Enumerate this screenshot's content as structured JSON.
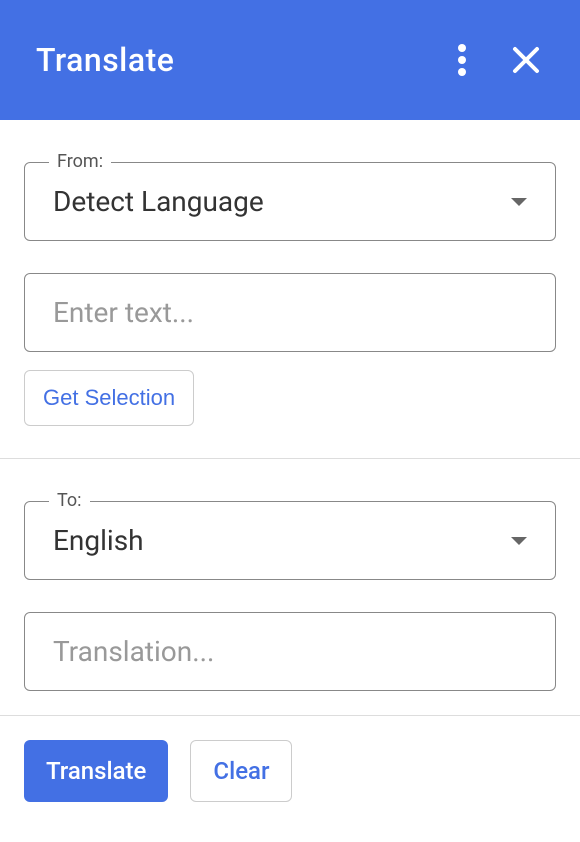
{
  "header": {
    "title": "Translate"
  },
  "from": {
    "label": "From:",
    "value": "Detect Language"
  },
  "input": {
    "placeholder": "Enter text..."
  },
  "getSelection": {
    "label": "Get Selection"
  },
  "to": {
    "label": "To:",
    "value": "English"
  },
  "output": {
    "placeholder": "Translation..."
  },
  "actions": {
    "translate": "Translate",
    "clear": "Clear"
  }
}
